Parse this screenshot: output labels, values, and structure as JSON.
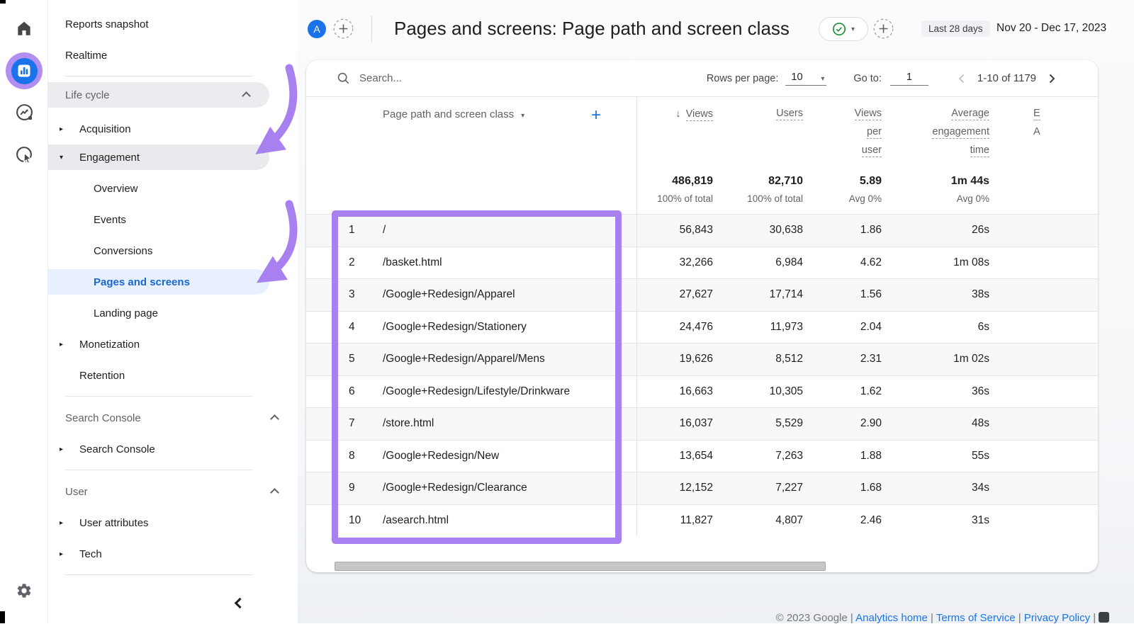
{
  "colors": {
    "accent_purple": "#a980f0",
    "google_blue": "#1a73e8",
    "selected_blue": "#1967d2",
    "selected_bg": "#e8f0fe",
    "check_green": "#1e8e3e"
  },
  "icons": {
    "rail": [
      "home-icon",
      "reports-bar-chart-icon",
      "explore-icon",
      "advertising-icon",
      "settings-gear-icon"
    ],
    "search": "magnifier",
    "report-status": "check-circle",
    "add": "dashed-plus-circle",
    "sort": "down-arrow",
    "sidebar_collapse": "chevron-left"
  },
  "header": {
    "avatar_letter": "A",
    "title": "Pages and screens: Page path and screen class",
    "date_range_label": "Last 28 days",
    "date_range": "Nov 20 - Dec 17, 2023"
  },
  "sidebar": {
    "items": [
      {
        "kind": "top",
        "id": "reports-snapshot",
        "label": "Reports snapshot"
      },
      {
        "kind": "top",
        "id": "realtime",
        "label": "Realtime"
      },
      {
        "kind": "divider"
      },
      {
        "kind": "section",
        "id": "life-cycle",
        "label": "Life cycle",
        "pill": true,
        "chevron": "up"
      },
      {
        "kind": "parent",
        "id": "acquisition",
        "label": "Acquisition",
        "arrow": "right",
        "gap": 8
      },
      {
        "kind": "parent",
        "id": "engagement",
        "label": "Engagement",
        "arrow": "down",
        "highlight": true
      },
      {
        "kind": "child",
        "id": "overview",
        "label": "Overview",
        "gap": 4
      },
      {
        "kind": "child",
        "id": "events",
        "label": "Events"
      },
      {
        "kind": "child",
        "id": "conversions",
        "label": "Conversions"
      },
      {
        "kind": "child",
        "id": "pages-and-screens",
        "label": "Pages and screens",
        "selected": true
      },
      {
        "kind": "child",
        "id": "landing-page",
        "label": "Landing page"
      },
      {
        "kind": "parent",
        "id": "monetization",
        "label": "Monetization",
        "arrow": "right"
      },
      {
        "kind": "parent",
        "id": "retention",
        "label": "Retention",
        "arrow": "none"
      },
      {
        "kind": "divider"
      },
      {
        "kind": "section",
        "id": "search-console-header",
        "label": "Search Console",
        "chevron": "up"
      },
      {
        "kind": "parent",
        "id": "search-console",
        "label": "Search Console",
        "arrow": "right"
      },
      {
        "kind": "divider"
      },
      {
        "kind": "section",
        "id": "user-header",
        "label": "User",
        "chevron": "up"
      },
      {
        "kind": "parent",
        "id": "user-attributes",
        "label": "User attributes",
        "arrow": "right"
      },
      {
        "kind": "parent",
        "id": "tech",
        "label": "Tech",
        "arrow": "right"
      },
      {
        "kind": "divider"
      }
    ]
  },
  "controls": {
    "search_placeholder": "Search...",
    "rows_per_page_label": "Rows per page:",
    "rows_per_page_value": "10",
    "goto_label": "Go to:",
    "goto_value": "1",
    "pagination_range": "1-10 of 1179"
  },
  "table": {
    "dimension_header": "Page path and screen class",
    "columns": [
      {
        "name": "views",
        "lines": [
          "Views"
        ],
        "sort": "desc",
        "align": "right"
      },
      {
        "name": "users",
        "lines": [
          "Users"
        ],
        "align": "right"
      },
      {
        "name": "views-per-user",
        "lines": [
          "Views",
          "per",
          "user"
        ],
        "align": "right"
      },
      {
        "name": "avg-engagement-time",
        "lines": [
          "Average",
          "engagement",
          "time"
        ],
        "align": "right"
      },
      {
        "name": "event-count-clipped",
        "lines": [
          "E",
          "A"
        ],
        "align": "left",
        "clipped": true
      }
    ],
    "totals": [
      {
        "value": "486,819",
        "sub": "100% of total"
      },
      {
        "value": "82,710",
        "sub": "100% of total"
      },
      {
        "value": "5.89",
        "sub": "Avg 0%"
      },
      {
        "value": "1m 44s",
        "sub": "Avg 0%"
      },
      {
        "value": "",
        "sub": ""
      }
    ],
    "rows": [
      {
        "index": "1",
        "path": "/",
        "views": "56,843",
        "users": "30,638",
        "views_per_user": "1.86",
        "avg_engagement_time": "26s"
      },
      {
        "index": "2",
        "path": "/basket.html",
        "views": "32,266",
        "users": "6,984",
        "views_per_user": "4.62",
        "avg_engagement_time": "1m 08s"
      },
      {
        "index": "3",
        "path": "/Google+Redesign/Apparel",
        "views": "27,627",
        "users": "17,714",
        "views_per_user": "1.56",
        "avg_engagement_time": "38s"
      },
      {
        "index": "4",
        "path": "/Google+Redesign/Stationery",
        "views": "24,476",
        "users": "11,973",
        "views_per_user": "2.04",
        "avg_engagement_time": "6s"
      },
      {
        "index": "5",
        "path": "/Google+Redesign/Apparel/Mens",
        "views": "19,626",
        "users": "8,512",
        "views_per_user": "2.31",
        "avg_engagement_time": "1m 02s"
      },
      {
        "index": "6",
        "path": "/Google+Redesign/Lifestyle/Drinkware",
        "views": "16,663",
        "users": "10,305",
        "views_per_user": "1.62",
        "avg_engagement_time": "36s"
      },
      {
        "index": "7",
        "path": "/store.html",
        "views": "16,037",
        "users": "5,529",
        "views_per_user": "2.90",
        "avg_engagement_time": "48s"
      },
      {
        "index": "8",
        "path": "/Google+Redesign/New",
        "views": "13,654",
        "users": "7,263",
        "views_per_user": "1.88",
        "avg_engagement_time": "55s"
      },
      {
        "index": "9",
        "path": "/Google+Redesign/Clearance",
        "views": "12,152",
        "users": "7,227",
        "views_per_user": "1.68",
        "avg_engagement_time": "34s"
      },
      {
        "index": "10",
        "path": "/asearch.html",
        "views": "11,827",
        "users": "4,807",
        "views_per_user": "2.46",
        "avg_engagement_time": "31s"
      }
    ]
  },
  "footer": {
    "copyright": "© 2023 Google",
    "links": [
      "Analytics home",
      "Terms of Service",
      "Privacy Policy"
    ]
  }
}
